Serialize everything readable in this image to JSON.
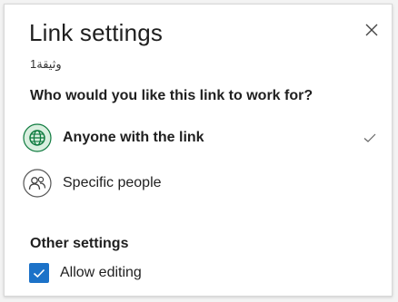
{
  "dialog": {
    "title": "Link settings",
    "subtitle": "وثيقة1",
    "question": "Who would you like this link to work for?",
    "close_icon": "close-icon"
  },
  "options": [
    {
      "label": "Anyone with the link",
      "icon": "globe-icon",
      "selected": true
    },
    {
      "label": "Specific people",
      "icon": "people-icon",
      "selected": false
    }
  ],
  "other_settings": {
    "title": "Other settings",
    "allow_editing_label": "Allow editing",
    "allow_editing_checked": true
  },
  "colors": {
    "accent": "#1c72c8",
    "globe_green": "#0f7b3f",
    "globe_bg": "#d9efdf"
  }
}
